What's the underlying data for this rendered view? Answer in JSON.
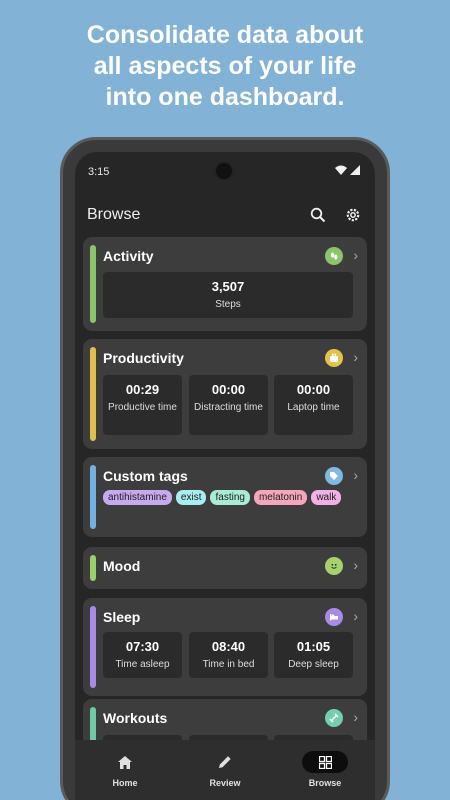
{
  "headline": "Consolidate data about\nall aspects of your life\ninto one dashboard.",
  "status": {
    "time": "3:15"
  },
  "appbar": {
    "title": "Browse",
    "search_icon": "search-icon",
    "settings_icon": "gear-icon"
  },
  "cards": {
    "activity": {
      "title": "Activity",
      "accent": "#8bc46a",
      "badge_color": "#8bc46a",
      "badge_icon": "footsteps-icon",
      "stats": [
        {
          "value": "3,507",
          "label": "Steps"
        }
      ]
    },
    "productivity": {
      "title": "Productivity",
      "accent": "#e0bd4f",
      "badge_color": "#e7c24a",
      "badge_icon": "briefcase-icon",
      "stats": [
        {
          "value": "00:29",
          "label": "Productive time"
        },
        {
          "value": "00:00",
          "label": "Distracting time"
        },
        {
          "value": "00:00",
          "label": "Laptop time"
        }
      ]
    },
    "custom_tags": {
      "title": "Custom tags",
      "accent": "#74b1e0",
      "badge_color": "#7fb9e6",
      "badge_icon": "tag-icon",
      "tags": [
        {
          "label": "antihistamine",
          "color": "#c7a9f0"
        },
        {
          "label": "exist",
          "color": "#a6eef0"
        },
        {
          "label": "fasting",
          "color": "#a8ecd4"
        },
        {
          "label": "melatonin",
          "color": "#f4a6bb"
        },
        {
          "label": "walk",
          "color": "#f1b0e6"
        }
      ]
    },
    "mood": {
      "title": "Mood",
      "accent": "#9bd067",
      "badge_color": "#a2d46a",
      "badge_icon": "smiley-icon"
    },
    "sleep": {
      "title": "Sleep",
      "accent": "#a98be6",
      "badge_color": "#a98be6",
      "badge_icon": "bed-icon",
      "stats": [
        {
          "value": "07:30",
          "label": "Time asleep"
        },
        {
          "value": "08:40",
          "label": "Time in bed"
        },
        {
          "value": "01:05",
          "label": "Deep sleep"
        }
      ]
    },
    "workouts": {
      "title": "Workouts",
      "accent": "#6ec9a6",
      "badge_color": "#73cfad",
      "badge_icon": "dumbbell-icon"
    }
  },
  "nav": [
    {
      "label": "Home",
      "icon": "home-icon",
      "active": false
    },
    {
      "label": "Review",
      "icon": "pencil-icon",
      "active": false
    },
    {
      "label": "Browse",
      "icon": "grid-icon",
      "active": true
    }
  ]
}
